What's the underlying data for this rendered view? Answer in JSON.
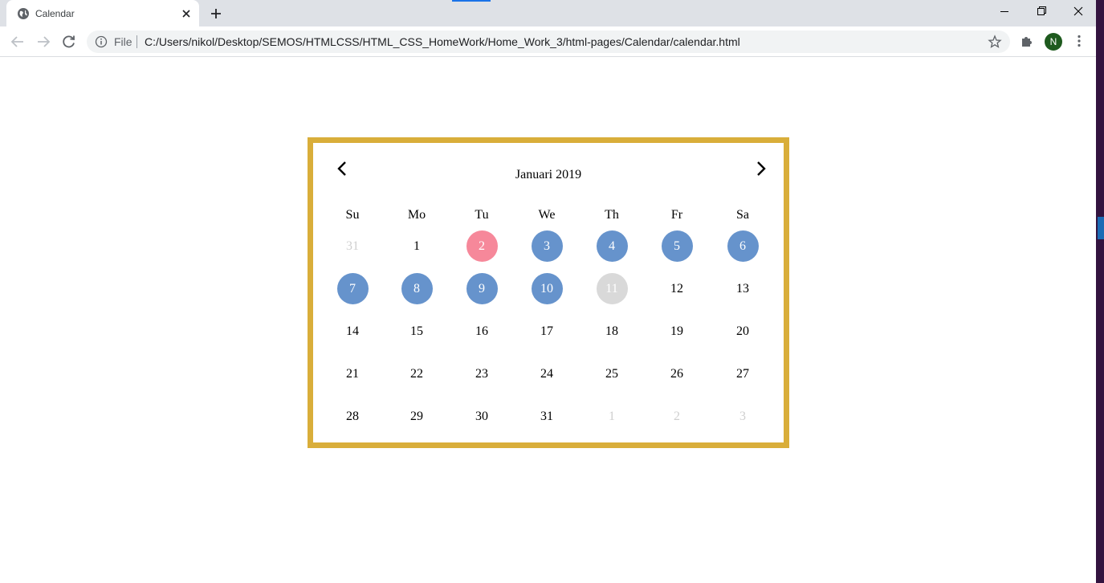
{
  "browser": {
    "tab_title": "Calendar",
    "omnibox": {
      "scheme_label": "File",
      "url": "C:/Users/nikol/Desktop/SEMOS/HTMLCSS/HTML_CSS_HomeWork/Home_Work_3/html-pages/Calendar/calendar.html"
    },
    "profile_initial": "N",
    "colors": {
      "avatar": "#1e5a1e",
      "tab_strip": "#dee1e6"
    }
  },
  "calendar": {
    "title": "Januari 2019",
    "prev_icon": "chevron-left-icon",
    "next_icon": "chevron-right-icon",
    "weekdays": [
      "Su",
      "Mo",
      "Tu",
      "We",
      "Th",
      "Fr",
      "Sa"
    ],
    "weeks": [
      [
        {
          "label": "31",
          "state": "muted"
        },
        {
          "label": "1",
          "state": "normal"
        },
        {
          "label": "2",
          "state": "today"
        },
        {
          "label": "3",
          "state": "selected"
        },
        {
          "label": "4",
          "state": "selected"
        },
        {
          "label": "5",
          "state": "selected"
        },
        {
          "label": "6",
          "state": "selected"
        }
      ],
      [
        {
          "label": "7",
          "state": "selected"
        },
        {
          "label": "8",
          "state": "selected"
        },
        {
          "label": "9",
          "state": "selected"
        },
        {
          "label": "10",
          "state": "selected"
        },
        {
          "label": "11",
          "state": "highlight"
        },
        {
          "label": "12",
          "state": "normal"
        },
        {
          "label": "13",
          "state": "normal"
        }
      ],
      [
        {
          "label": "14",
          "state": "normal"
        },
        {
          "label": "15",
          "state": "normal"
        },
        {
          "label": "16",
          "state": "normal"
        },
        {
          "label": "17",
          "state": "normal"
        },
        {
          "label": "18",
          "state": "normal"
        },
        {
          "label": "19",
          "state": "normal"
        },
        {
          "label": "20",
          "state": "normal"
        }
      ],
      [
        {
          "label": "21",
          "state": "normal"
        },
        {
          "label": "22",
          "state": "normal"
        },
        {
          "label": "23",
          "state": "normal"
        },
        {
          "label": "24",
          "state": "normal"
        },
        {
          "label": "25",
          "state": "normal"
        },
        {
          "label": "26",
          "state": "normal"
        },
        {
          "label": "27",
          "state": "normal"
        }
      ],
      [
        {
          "label": "28",
          "state": "normal"
        },
        {
          "label": "29",
          "state": "normal"
        },
        {
          "label": "30",
          "state": "normal"
        },
        {
          "label": "31",
          "state": "normal"
        },
        {
          "label": "1",
          "state": "muted"
        },
        {
          "label": "2",
          "state": "muted"
        },
        {
          "label": "3",
          "state": "muted"
        }
      ]
    ],
    "colors": {
      "border": "#d9ae3a",
      "today": "#f6889a",
      "selected": "#6693cc",
      "highlight": "#d9d9d9",
      "muted_text": "#cfcfcf"
    }
  }
}
